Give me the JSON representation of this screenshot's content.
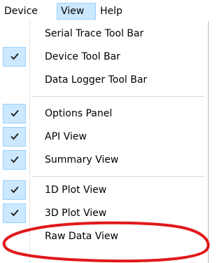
{
  "menubar": {
    "items": [
      {
        "label": "Device"
      },
      {
        "label": "View"
      },
      {
        "label": "Help"
      }
    ]
  },
  "view_menu": {
    "items": [
      {
        "label": "Serial Trace Tool Bar",
        "checked": false
      },
      {
        "label": "Device Tool Bar",
        "checked": true
      },
      {
        "label": "Data Logger Tool Bar",
        "checked": false
      },
      {
        "label": "Options Panel",
        "checked": true
      },
      {
        "label": "API View",
        "checked": true
      },
      {
        "label": "Summary View",
        "checked": true
      },
      {
        "label": "1D Plot View",
        "checked": true
      },
      {
        "label": "3D Plot View",
        "checked": true
      },
      {
        "label": "Raw Data View",
        "checked": false
      }
    ]
  },
  "colors": {
    "highlight_bg": "#cce8ff",
    "highlight_border": "#99d1ff",
    "annotation": "#e0191b"
  }
}
